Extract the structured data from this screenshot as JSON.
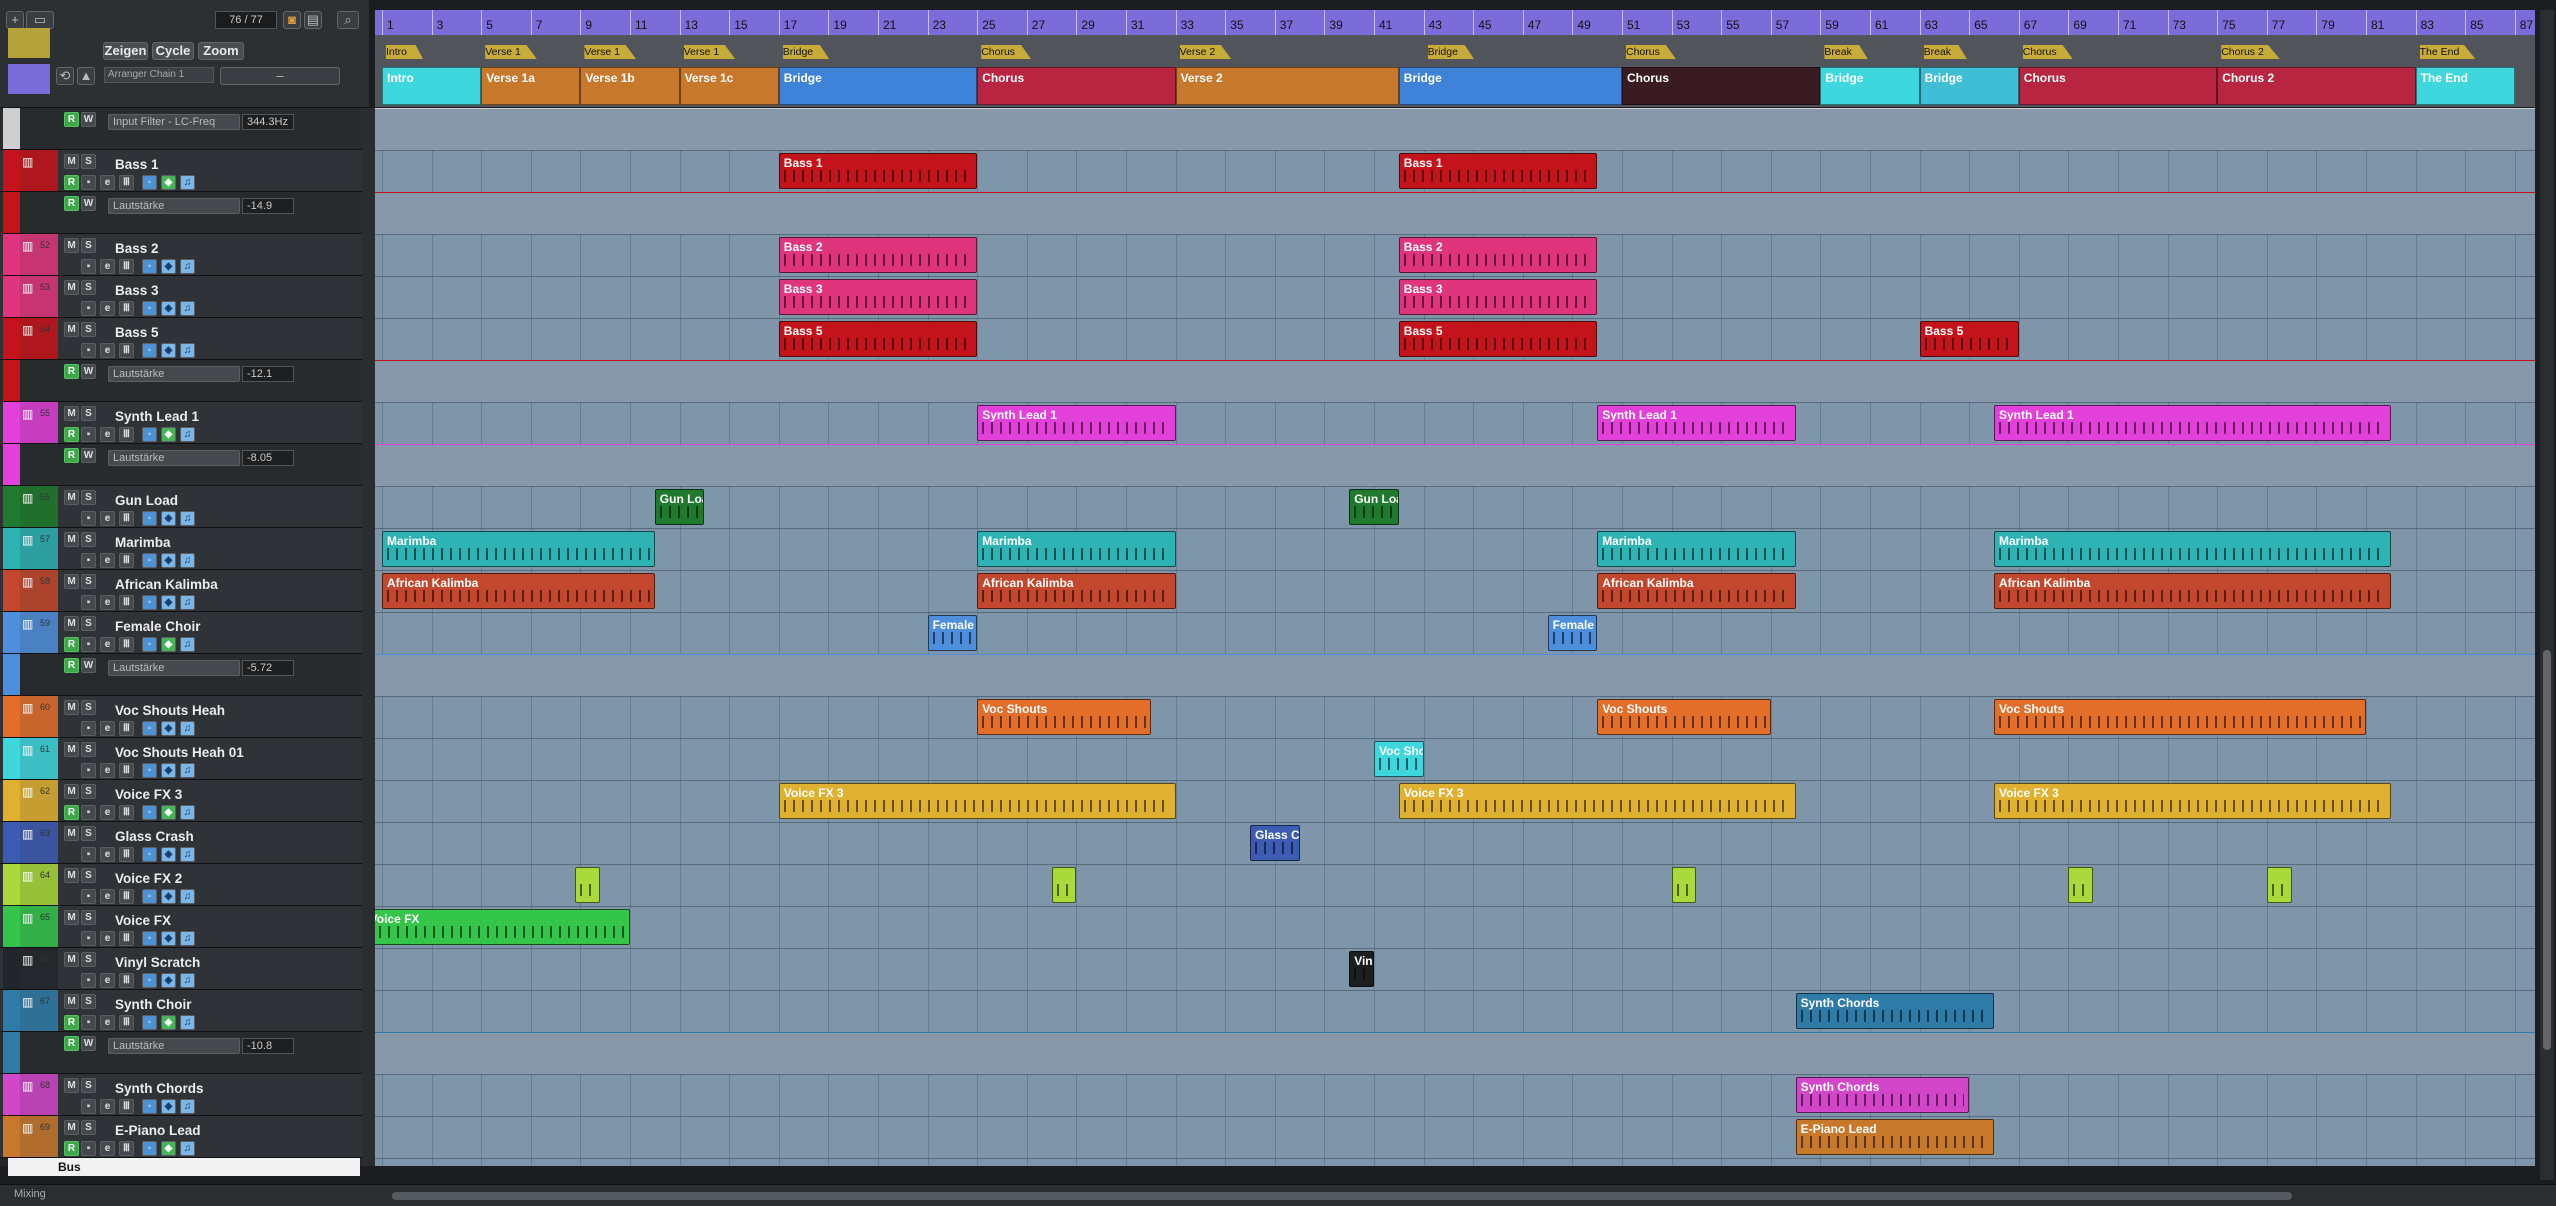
{
  "toolbar": {
    "zeigen": "Zeigen",
    "cycle": "Cycle",
    "zoom": "Zoom",
    "counter": "76 / 77",
    "arranger_chain": "Arranger Chain 1"
  },
  "ruler": {
    "labels": [
      "1",
      "3",
      "5",
      "7",
      "9",
      "11",
      "13",
      "15",
      "17",
      "19",
      "21",
      "23",
      "25",
      "27",
      "29",
      "31",
      "33",
      "35",
      "37",
      "39",
      "41",
      "43",
      "45",
      "47",
      "49",
      "51",
      "53",
      "55",
      "57",
      "59",
      "61",
      "63",
      "65",
      "67",
      "69",
      "71",
      "73",
      "75",
      "77",
      "79",
      "81",
      "83",
      "85",
      "87"
    ]
  },
  "markers": [
    {
      "label": "Intro",
      "bar": 1
    },
    {
      "label": "Verse 1",
      "bar": 5
    },
    {
      "label": "Verse 1",
      "bar": 9
    },
    {
      "label": "Verse 1",
      "bar": 13
    },
    {
      "label": "Bridge",
      "bar": 17
    },
    {
      "label": "Chorus",
      "bar": 25
    },
    {
      "label": "Verse 2",
      "bar": 33
    },
    {
      "label": "Bridge",
      "bar": 43
    },
    {
      "label": "Chorus",
      "bar": 51
    },
    {
      "label": "Break",
      "bar": 59
    },
    {
      "label": "Break",
      "bar": 63
    },
    {
      "label": "Chorus",
      "bar": 67
    },
    {
      "label": "Chorus 2",
      "bar": 75
    },
    {
      "label": "The End",
      "bar": 83
    }
  ],
  "sections": [
    {
      "label": "Intro",
      "start": 1,
      "end": 5,
      "color": "#3ed7de"
    },
    {
      "label": "Verse 1a",
      "start": 5,
      "end": 9,
      "color": "#c7782b"
    },
    {
      "label": "Verse 1b",
      "start": 9,
      "end": 13,
      "color": "#c7782b"
    },
    {
      "label": "Verse 1c",
      "start": 13,
      "end": 17,
      "color": "#c7782b"
    },
    {
      "label": "Bridge",
      "start": 17,
      "end": 25,
      "color": "#3f82da"
    },
    {
      "label": "Chorus",
      "start": 25,
      "end": 33,
      "color": "#b82540"
    },
    {
      "label": "Verse 2",
      "start": 33,
      "end": 42,
      "color": "#c7782b"
    },
    {
      "label": "Bridge",
      "start": 42,
      "end": 51,
      "color": "#3f82da"
    },
    {
      "label": "Chorus",
      "start": 51,
      "end": 59,
      "color": "#3a1b22"
    },
    {
      "label": "Bridge",
      "start": 59,
      "end": 63,
      "color": "#3ed7de"
    },
    {
      "label": "Bridge",
      "start": 63,
      "end": 67,
      "color": "#3fbfd6"
    },
    {
      "label": "Chorus",
      "start": 67,
      "end": 75,
      "color": "#b82540"
    },
    {
      "label": "Chorus 2",
      "start": 75,
      "end": 83,
      "color": "#b82540"
    },
    {
      "label": "The End",
      "start": 83,
      "end": 87,
      "color": "#3ed7de"
    }
  ],
  "tracks": [
    {
      "kind": "auto",
      "name": "Input Filter - LC-Freq",
      "value": "344.3Hz",
      "color": "#cfcfcf"
    },
    {
      "kind": "track",
      "name": "Bass 1",
      "num": "",
      "color": "#c4131a",
      "buttons": "full"
    },
    {
      "kind": "auto",
      "name": "Lautstärke",
      "value": "-14.9",
      "color": "#c4131a"
    },
    {
      "kind": "track",
      "name": "Bass 2",
      "num": "52",
      "color": "#e0357d",
      "buttons": "basic"
    },
    {
      "kind": "track",
      "name": "Bass 3",
      "num": "53",
      "color": "#e0357d",
      "buttons": "basic"
    },
    {
      "kind": "track",
      "name": "Bass 5",
      "num": "54",
      "color": "#c4131a",
      "buttons": "basic"
    },
    {
      "kind": "auto",
      "name": "Lautstärke",
      "value": "-12.1",
      "color": "#c4131a"
    },
    {
      "kind": "track",
      "name": "Synth Lead 1",
      "num": "55",
      "color": "#e240d8",
      "buttons": "full"
    },
    {
      "kind": "auto",
      "name": "Lautstärke",
      "value": "-8.05",
      "color": "#e240d8"
    },
    {
      "kind": "track",
      "name": "Gun Load",
      "num": "56",
      "color": "#1e7a2c",
      "buttons": "basic"
    },
    {
      "kind": "track",
      "name": "Marimba",
      "num": "57",
      "color": "#2db3b3",
      "buttons": "basic"
    },
    {
      "kind": "track",
      "name": "African Kalimba",
      "num": "58",
      "color": "#c2472c",
      "buttons": "basic"
    },
    {
      "kind": "track",
      "name": "Female Choir",
      "num": "59",
      "color": "#4d8fdc",
      "buttons": "full"
    },
    {
      "kind": "auto",
      "name": "Lautstärke",
      "value": "-5.72",
      "color": "#4d8fdc"
    },
    {
      "kind": "track",
      "name": "Voc Shouts Heah",
      "num": "60",
      "color": "#e36e2a",
      "buttons": "basic"
    },
    {
      "kind": "track",
      "name": "Voc Shouts Heah 01",
      "num": "61",
      "color": "#3ed7de",
      "buttons": "basic"
    },
    {
      "kind": "track",
      "name": "Voice FX 3",
      "num": "62",
      "color": "#e0b030",
      "buttons": "full"
    },
    {
      "kind": "track",
      "name": "Glass Crash",
      "num": "63",
      "color": "#3c5bb2",
      "buttons": "basic"
    },
    {
      "kind": "track",
      "name": "Voice FX 2",
      "num": "64",
      "color": "#a9d93a",
      "buttons": "basic"
    },
    {
      "kind": "track",
      "name": "Voice FX",
      "num": "65",
      "color": "#34c64a",
      "buttons": "basic"
    },
    {
      "kind": "track",
      "name": "Vinyl Scratch",
      "num": "66",
      "color": "#22262a",
      "buttons": "basic"
    },
    {
      "kind": "track",
      "name": "Synth Choir",
      "num": "67",
      "color": "#2f7ba8",
      "buttons": "full"
    },
    {
      "kind": "auto",
      "name": "Lautstärke",
      "value": "-10.8",
      "color": "#2f7ba8"
    },
    {
      "kind": "track",
      "name": "Synth Chords",
      "num": "68",
      "color": "#d246c9",
      "buttons": "basic"
    },
    {
      "kind": "track",
      "name": "E-Piano Lead",
      "num": "69",
      "color": "#c7782b",
      "buttons": "full"
    }
  ],
  "clips": [
    {
      "track": 1,
      "label": "Bass 1",
      "start": 17,
      "end": 25,
      "color": "#c4131a"
    },
    {
      "track": 1,
      "label": "Bass 1",
      "start": 42,
      "end": 50,
      "color": "#c4131a"
    },
    {
      "track": 3,
      "label": "Bass 2",
      "start": 17,
      "end": 25,
      "color": "#e0357d"
    },
    {
      "track": 3,
      "label": "Bass 2",
      "start": 42,
      "end": 50,
      "color": "#e0357d"
    },
    {
      "track": 4,
      "label": "Bass 3",
      "start": 17,
      "end": 25,
      "color": "#e0357d"
    },
    {
      "track": 4,
      "label": "Bass 3",
      "start": 42,
      "end": 50,
      "color": "#e0357d"
    },
    {
      "track": 5,
      "label": "Bass 5",
      "start": 17,
      "end": 25,
      "color": "#c4131a"
    },
    {
      "track": 5,
      "label": "Bass 5",
      "start": 42,
      "end": 50,
      "color": "#c4131a"
    },
    {
      "track": 5,
      "label": "Bass 5",
      "start": 63,
      "end": 67,
      "color": "#c4131a"
    },
    {
      "track": 7,
      "label": "Synth Lead 1",
      "start": 25,
      "end": 33,
      "color": "#e240d8"
    },
    {
      "track": 7,
      "label": "Synth Lead 1",
      "start": 50,
      "end": 58,
      "color": "#e240d8"
    },
    {
      "track": 7,
      "label": "Synth Lead 1",
      "start": 66,
      "end": 82,
      "color": "#e240d8"
    },
    {
      "track": 9,
      "label": "Gun Loa",
      "start": 12,
      "end": 14,
      "color": "#1e7a2c"
    },
    {
      "track": 9,
      "label": "Gun Loa",
      "start": 40,
      "end": 42,
      "color": "#1e7a2c"
    },
    {
      "track": 10,
      "label": "Marimba",
      "start": 1,
      "end": 12,
      "color": "#2db3b3"
    },
    {
      "track": 10,
      "label": "Marimba",
      "start": 25,
      "end": 33,
      "color": "#2db3b3"
    },
    {
      "track": 10,
      "label": "Marimba",
      "start": 50,
      "end": 58,
      "color": "#2db3b3"
    },
    {
      "track": 10,
      "label": "Marimba",
      "start": 66,
      "end": 82,
      "color": "#2db3b3"
    },
    {
      "track": 11,
      "label": "African Kalimba",
      "start": 1,
      "end": 12,
      "color": "#c2472c"
    },
    {
      "track": 11,
      "label": "African Kalimba",
      "start": 25,
      "end": 33,
      "color": "#c2472c"
    },
    {
      "track": 11,
      "label": "African Kalimba",
      "start": 50,
      "end": 58,
      "color": "#c2472c"
    },
    {
      "track": 11,
      "label": "African Kalimba",
      "start": 66,
      "end": 82,
      "color": "#c2472c"
    },
    {
      "track": 12,
      "label": "Female C",
      "start": 23,
      "end": 25,
      "color": "#4d8fdc"
    },
    {
      "track": 12,
      "label": "Female C",
      "start": 48,
      "end": 50,
      "color": "#4d8fdc"
    },
    {
      "track": 14,
      "label": "Voc Shouts",
      "start": 25,
      "end": 32,
      "color": "#e36e2a"
    },
    {
      "track": 14,
      "label": "Voc Shouts",
      "start": 50,
      "end": 57,
      "color": "#e36e2a"
    },
    {
      "track": 14,
      "label": "Voc Shouts",
      "start": 66,
      "end": 81,
      "color": "#e36e2a"
    },
    {
      "track": 15,
      "label": "Voc Sho",
      "start": 41,
      "end": 43,
      "color": "#3ed7de"
    },
    {
      "track": 16,
      "label": "Voice FX 3",
      "start": 17,
      "end": 33,
      "color": "#e0b030"
    },
    {
      "track": 16,
      "label": "Voice FX 3",
      "start": 42,
      "end": 58,
      "color": "#e0b030"
    },
    {
      "track": 16,
      "label": "Voice FX 3",
      "start": 66,
      "end": 82,
      "color": "#e0b030"
    },
    {
      "track": 17,
      "label": "Glass Cr",
      "start": 36,
      "end": 38,
      "color": "#3c5bb2"
    },
    {
      "track": 18,
      "label": "",
      "start": 8.8,
      "end": 9.8,
      "color": "#a9d93a"
    },
    {
      "track": 18,
      "label": "",
      "start": 28,
      "end": 29,
      "color": "#a9d93a"
    },
    {
      "track": 18,
      "label": "",
      "start": 53,
      "end": 54,
      "color": "#a9d93a"
    },
    {
      "track": 18,
      "label": "",
      "start": 69,
      "end": 70,
      "color": "#a9d93a"
    },
    {
      "track": 18,
      "label": "",
      "start": 77,
      "end": 78,
      "color": "#a9d93a"
    },
    {
      "track": 19,
      "label": "Voice FX",
      "start": 0.3,
      "end": 11,
      "color": "#34c64a"
    },
    {
      "track": 20,
      "label": "Viny",
      "start": 40,
      "end": 41,
      "color": "#1c1e20"
    },
    {
      "track": 21,
      "label": "Synth Chords",
      "start": 58,
      "end": 66,
      "color": "#2f7ba8"
    },
    {
      "track": 23,
      "label": "Synth Chords",
      "start": 58,
      "end": 65,
      "color": "#d246c9"
    },
    {
      "track": 24,
      "label": "E-Piano Lead",
      "start": 58,
      "end": 66,
      "color": "#c7782b"
    }
  ],
  "bus_label": "Bus",
  "status": {
    "mixing": "Mixing"
  }
}
